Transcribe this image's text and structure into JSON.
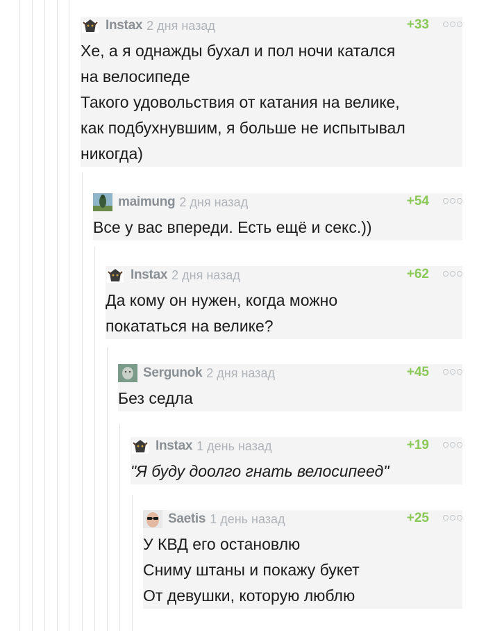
{
  "comments": [
    {
      "author": "Instax",
      "time": "2 дня назад",
      "rating": "+33",
      "avatar": "helmet-avatar",
      "lines": [
        "Хе, а я однажды бухал и пол ночи катался",
        "на велосипеде",
        "Такого удовольствия от катания на велике,",
        "как подбухнувшим, я больше не испытывал",
        "никогда)"
      ]
    },
    {
      "author": "maimung",
      "time": "2 дня назад",
      "rating": "+54",
      "avatar": "statue-avatar",
      "lines": [
        "Все у вас впереди. Есть ещё и секс.))"
      ]
    },
    {
      "author": "Instax",
      "time": "2 дня назад",
      "rating": "+62",
      "avatar": "helmet-avatar",
      "lines": [
        "Да кому он нужен, когда можно",
        "покататься на велике?"
      ]
    },
    {
      "author": "Sergunok",
      "time": "2 дня назад",
      "rating": "+45",
      "avatar": "photo-avatar",
      "lines": [
        "Без седла"
      ]
    },
    {
      "author": "Instax",
      "time": "1 день назад",
      "rating": "+19",
      "avatar": "helmet-avatar",
      "lines": [
        "\"Я буду доолго гнать велосипеед\""
      ]
    },
    {
      "author": "Saetis",
      "time": "1 день назад",
      "rating": "+25",
      "avatar": "sunglasses-avatar",
      "lines": [
        "У КВД его остановлю",
        "Сниму штаны и покажу букет",
        "От девушки, которую люблю"
      ]
    }
  ],
  "colors": {
    "rating": "#8ac858",
    "author": "#8a8f94",
    "time": "#b0b4b8",
    "background": "#f4f4f4",
    "thread_line": "#e3e3e3"
  }
}
